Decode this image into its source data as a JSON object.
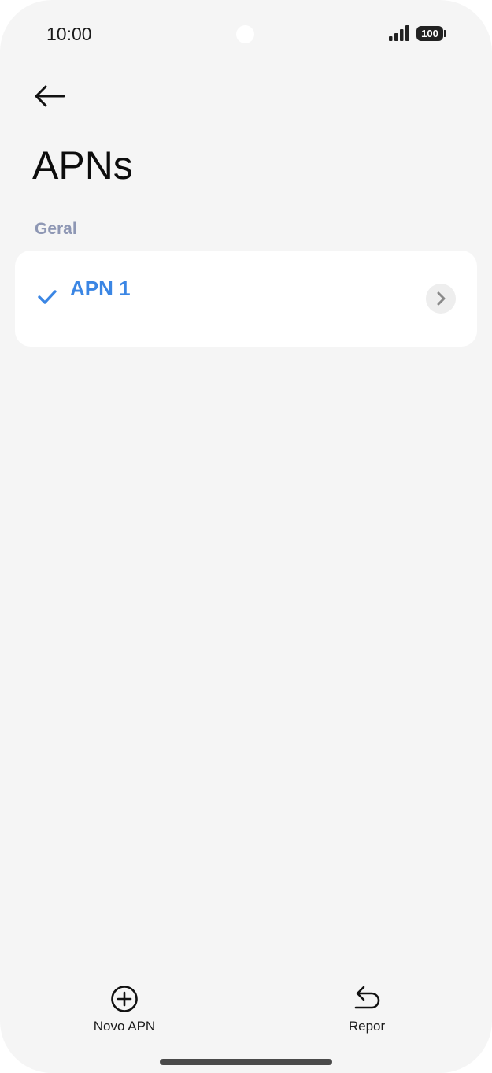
{
  "status_bar": {
    "time": "10:00",
    "battery": "100",
    "icons": [
      "signal-icon",
      "battery-icon"
    ]
  },
  "header": {
    "back_icon": "arrow-left-icon",
    "title": "APNs"
  },
  "section": {
    "label": "Geral"
  },
  "apn_list": [
    {
      "name": "APN 1",
      "selected": true,
      "icon": "check-icon",
      "action_icon": "chevron-right-icon"
    }
  ],
  "bottom_bar": {
    "new_apn_label": "Novo APN",
    "new_apn_icon": "plus-circle-icon",
    "reset_label": "Repor",
    "reset_icon": "undo-icon"
  },
  "colors": {
    "accent": "#3b86e4",
    "section_header": "#8e97b4",
    "background": "#f5f5f5",
    "card": "#ffffff"
  }
}
